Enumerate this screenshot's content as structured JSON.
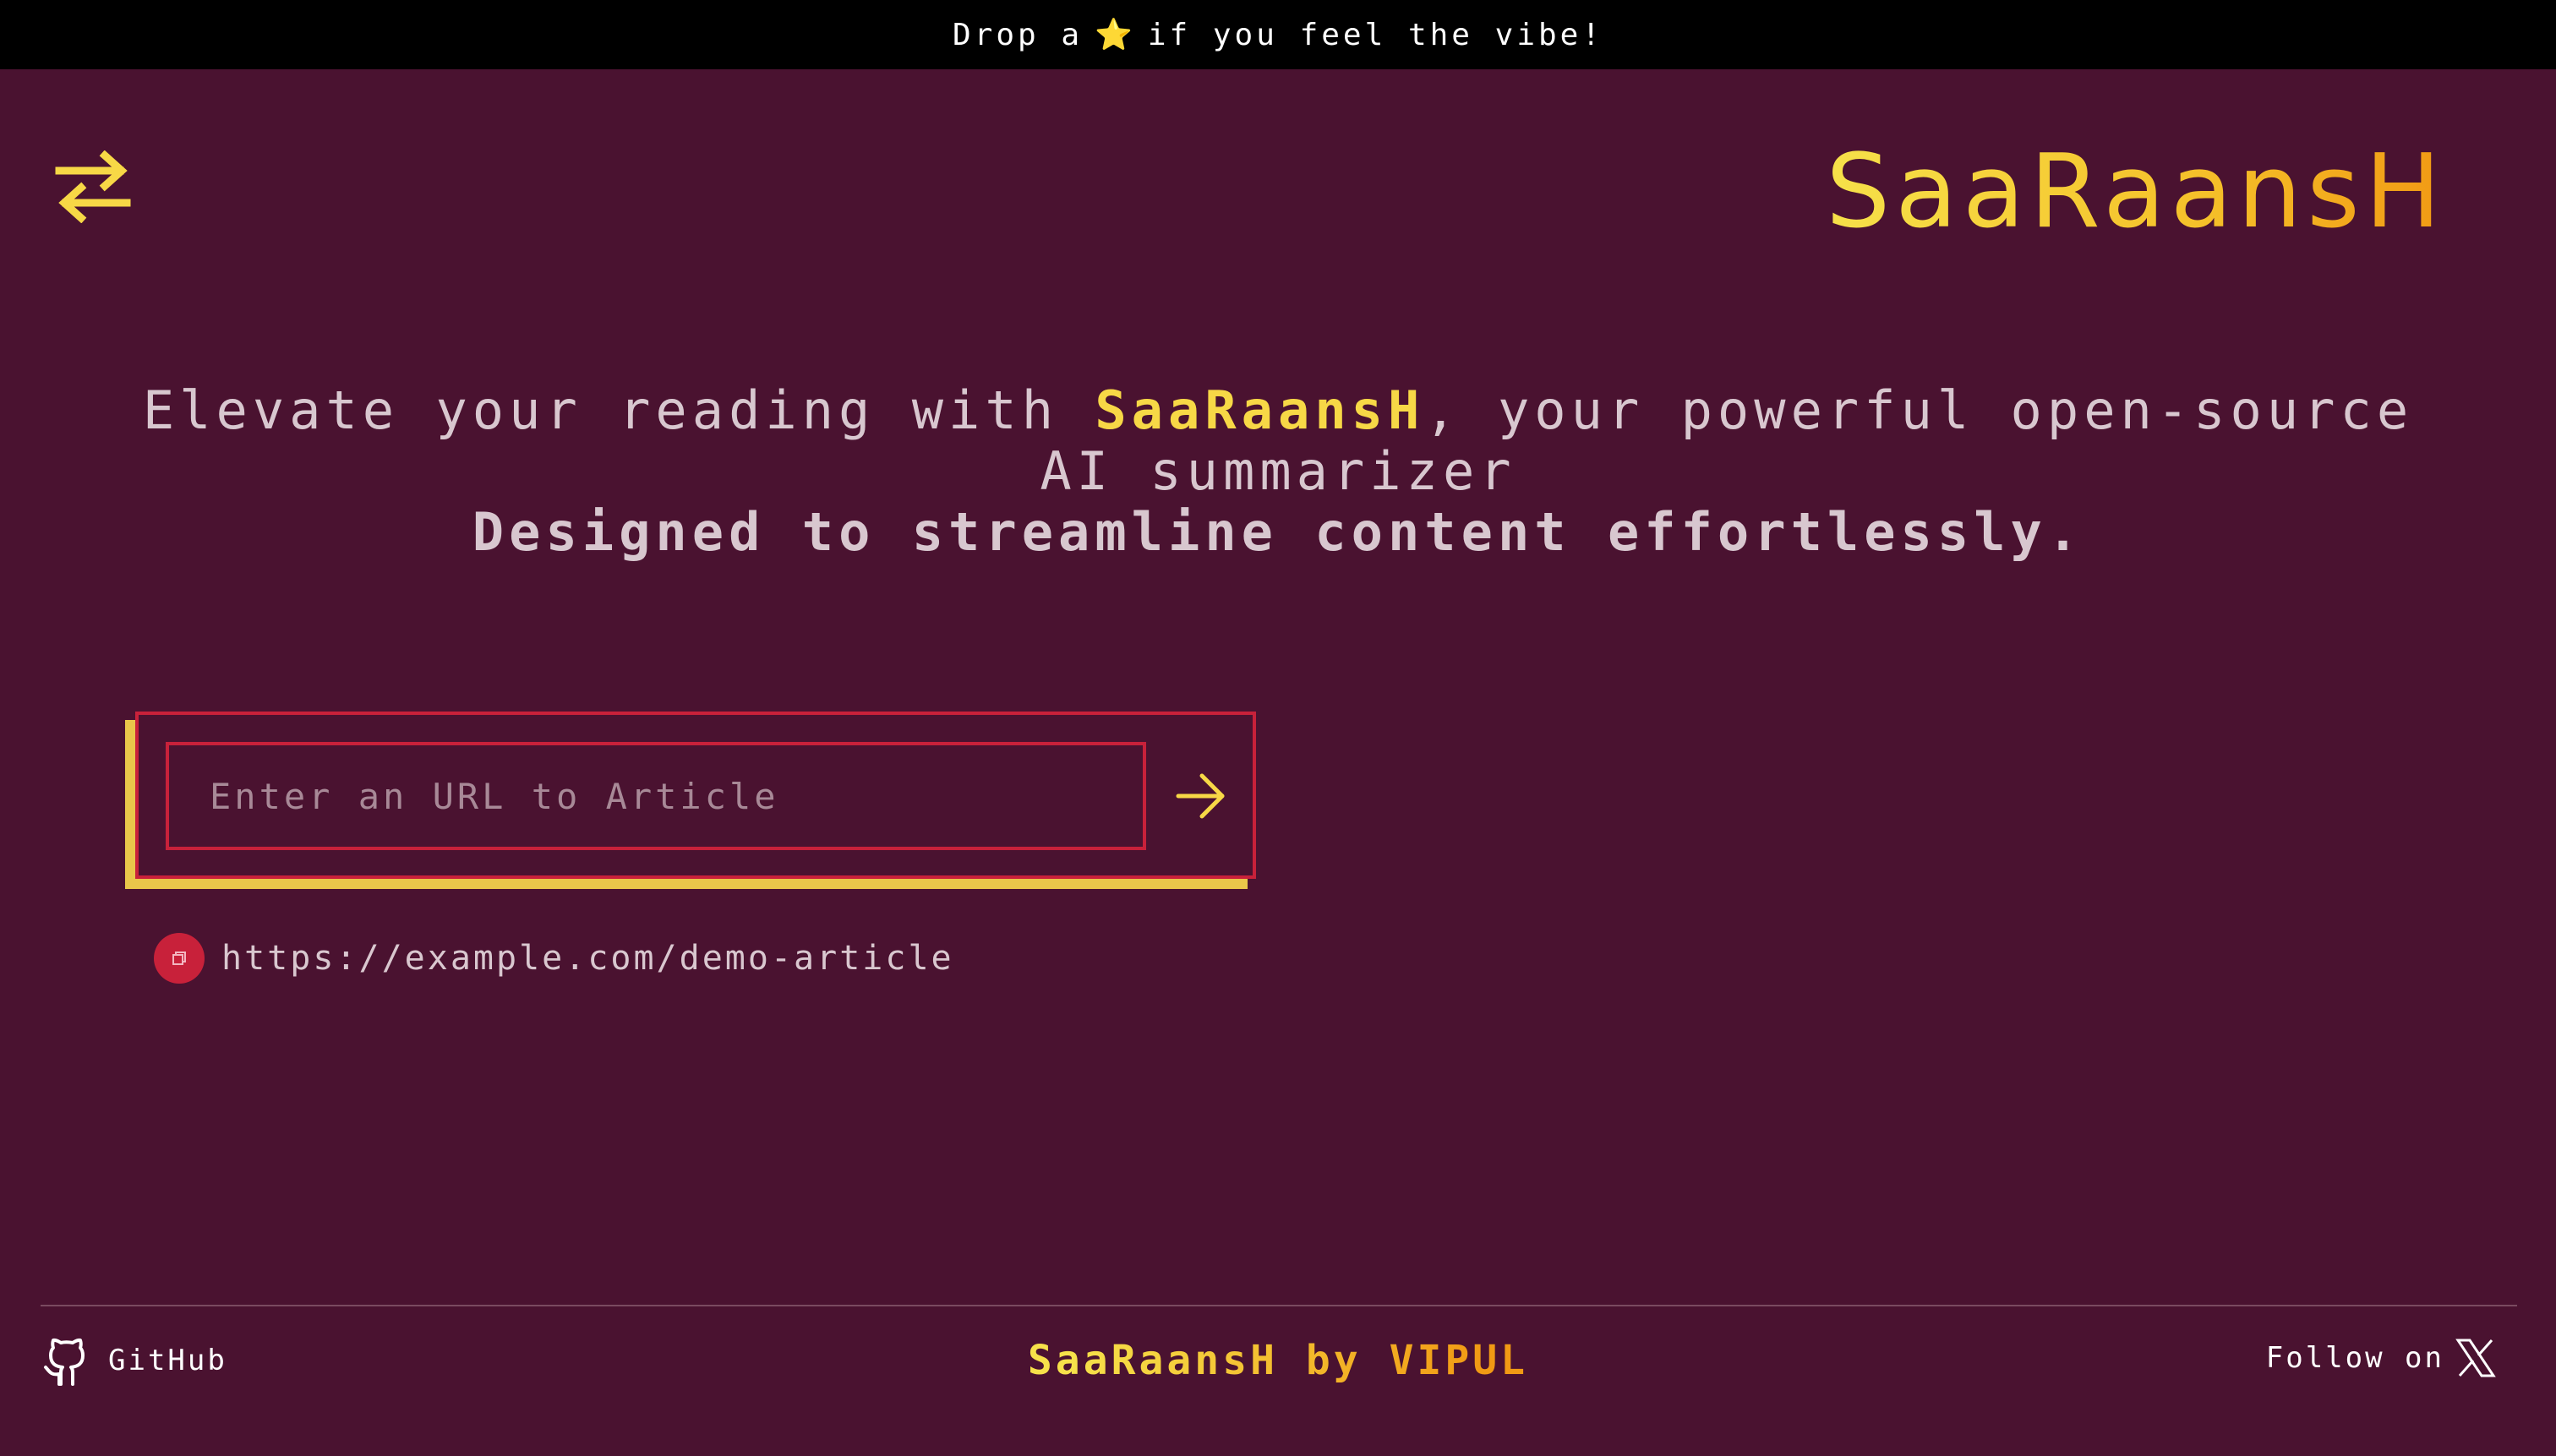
{
  "banner": {
    "text_before": "Drop a",
    "star": "⭐",
    "text_after": "if you feel the vibe!"
  },
  "header": {
    "logo_text": "SaaRaansH",
    "swap_icon": "swap-arrows-icon"
  },
  "hero": {
    "line_before": "Elevate your reading with ",
    "brand": "SaaRaansH",
    "line_after": ", your powerful open-source AI summarizer",
    "tagline": "Designed to streamline content effortlessly."
  },
  "url_form": {
    "placeholder": "Enter an URL to Article",
    "value": "",
    "submit_icon": "arrow-right-icon"
  },
  "history": {
    "items": [
      {
        "url": "https://example.com/demo-article",
        "icon": "copy-icon"
      }
    ]
  },
  "footer": {
    "github_label": "GitHub",
    "brand_text": "SaaRaansH by VIPUL",
    "follow_label": "Follow on",
    "x_icon": "x-logo-icon"
  },
  "colors": {
    "background": "#4a1230",
    "accent_yellow": "#f7d846",
    "accent_red": "#c8213a",
    "banner_bg": "#000000"
  }
}
